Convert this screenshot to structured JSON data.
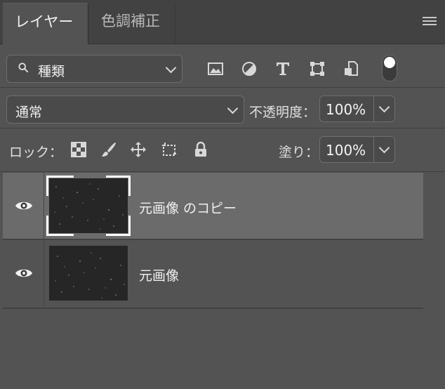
{
  "tabs": {
    "active": "レイヤー",
    "inactive": "色調補正"
  },
  "filter": {
    "label": "種類",
    "icons": [
      "image-filter-icon",
      "adjustment-filter-icon",
      "type-filter-icon",
      "shape-filter-icon",
      "smart-object-filter-icon"
    ]
  },
  "blend": {
    "mode": "通常",
    "opacity_label": "不透明度：",
    "opacity_value": "100%"
  },
  "lock": {
    "label": "ロック：",
    "icons": [
      "lock-transparent-pixels-icon",
      "lock-image-pixels-icon",
      "lock-position-icon",
      "lock-artboard-icon",
      "lock-all-icon"
    ]
  },
  "fill": {
    "label": "塗り：",
    "value": "100%"
  },
  "layers": [
    {
      "name": "元画像 のコピー",
      "visible": true,
      "selected": true
    },
    {
      "name": "元画像",
      "visible": true,
      "selected": false
    }
  ],
  "colors": {
    "panel_bg": "#535353",
    "selected_row": "#6b6b6b",
    "tabbar_bg": "#424242"
  }
}
